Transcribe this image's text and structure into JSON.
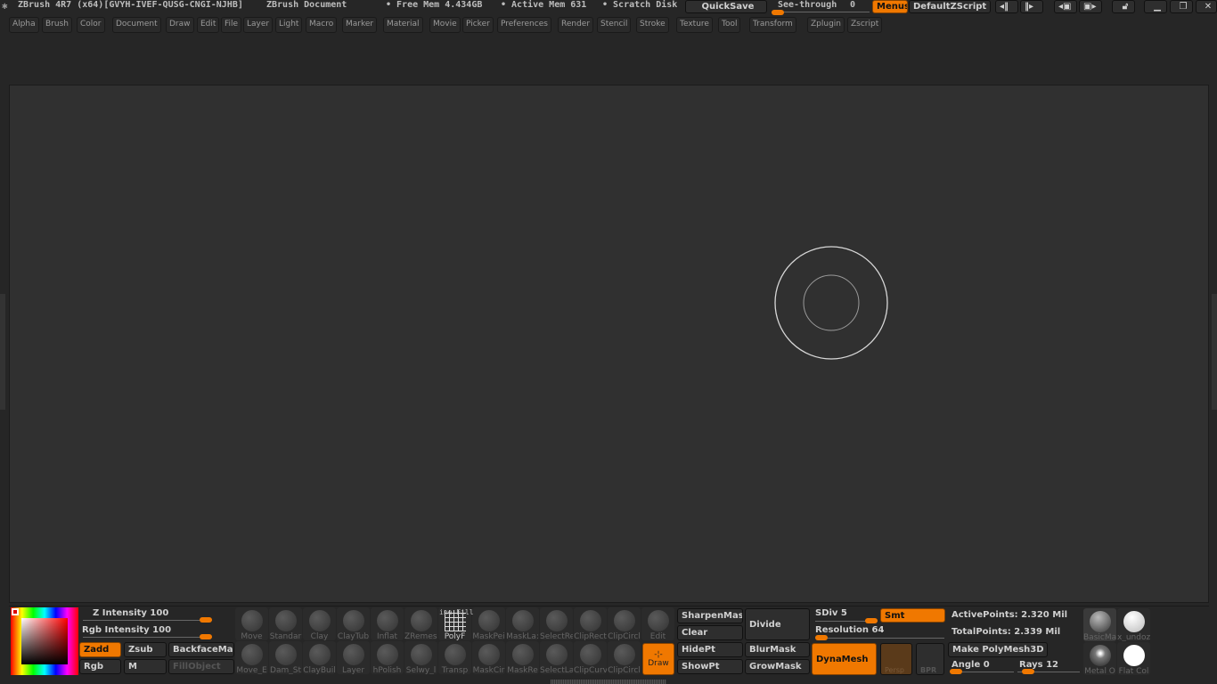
{
  "titlebar": {
    "app": "ZBrush 4R7 (x64)[GVYH-IVEF-QUSG-CNGI-NJHB]",
    "document": "ZBrush Document",
    "free_mem": "• Free Mem 4.434GB",
    "active_mem": "• Active Mem 631",
    "scratch": "• Scratch Disk",
    "quicksave": "QuickSave",
    "see_through_label": "See-through",
    "see_through_value": "0",
    "menus": "Menus",
    "default_zscript": "DefaultZScript"
  },
  "menus": [
    "Alpha",
    "Brush",
    "Color",
    "Document",
    "Draw",
    "Edit",
    "File",
    "Layer",
    "Light",
    "Macro",
    "Marker",
    "Material",
    "Movie",
    "Picker",
    "Preferences",
    "Render",
    "Stencil",
    "Stroke",
    "Texture",
    "Tool",
    "Transform",
    "Zplugin",
    "Zscript"
  ],
  "shelf": {
    "z_intensity": "Z Intensity 100",
    "rgb_intensity": "Rgb Intensity 100",
    "z_intensity_value": 100,
    "rgb_intensity_value": 100,
    "zadd": "Zadd",
    "zsub": "Zsub",
    "backface": "BackfaceMas",
    "rgb": "Rgb",
    "m": "M",
    "fillobject": "FillObject",
    "brushes_row1": [
      "Move",
      "Standar",
      "Clay",
      "ClayTub",
      "Inflat",
      "ZRemesl",
      "PolyF",
      "MaskPei",
      "MaskLa:",
      "SelectRe",
      "ClipRect",
      "ClipCircl",
      "Edit"
    ],
    "brushes_row2": [
      "Move_E",
      "Dam_St",
      "ClayBuil",
      "Layer",
      "hPolish",
      "Selwy_l",
      "Transp",
      "MaskCir",
      "MaskRe",
      "SelectLa",
      "ClipCurv",
      "ClipCircl"
    ],
    "polyfill_top": "ine Fill",
    "draw": "Draw",
    "sharpen": "SharpenMasl",
    "clear": "Clear",
    "hidept": "HidePt",
    "showpt": "ShowPt",
    "divide": "Divide",
    "blurmask": "BlurMask",
    "growmask": "GrowMask",
    "sdiv": "SDiv 5",
    "smt": "Smt",
    "resolution": "Resolution 64",
    "dynamesh": "DynaMesh",
    "persp": "Persp",
    "bpr": "BPR",
    "active_points": "ActivePoints: 2.320  Mil",
    "total_points": "TotalPoints: 2.339  Mil",
    "make_polymesh": "Make PolyMesh3D",
    "angle": "Angle 0",
    "rays": "Rays 12",
    "mat1": "BasicMa",
    "mat2": "x_undoz",
    "mat3": "Metal O",
    "mat4": "Flat Col"
  },
  "colors": {
    "accent": "#f07800",
    "canvas": "#303030",
    "background": "#262626"
  }
}
